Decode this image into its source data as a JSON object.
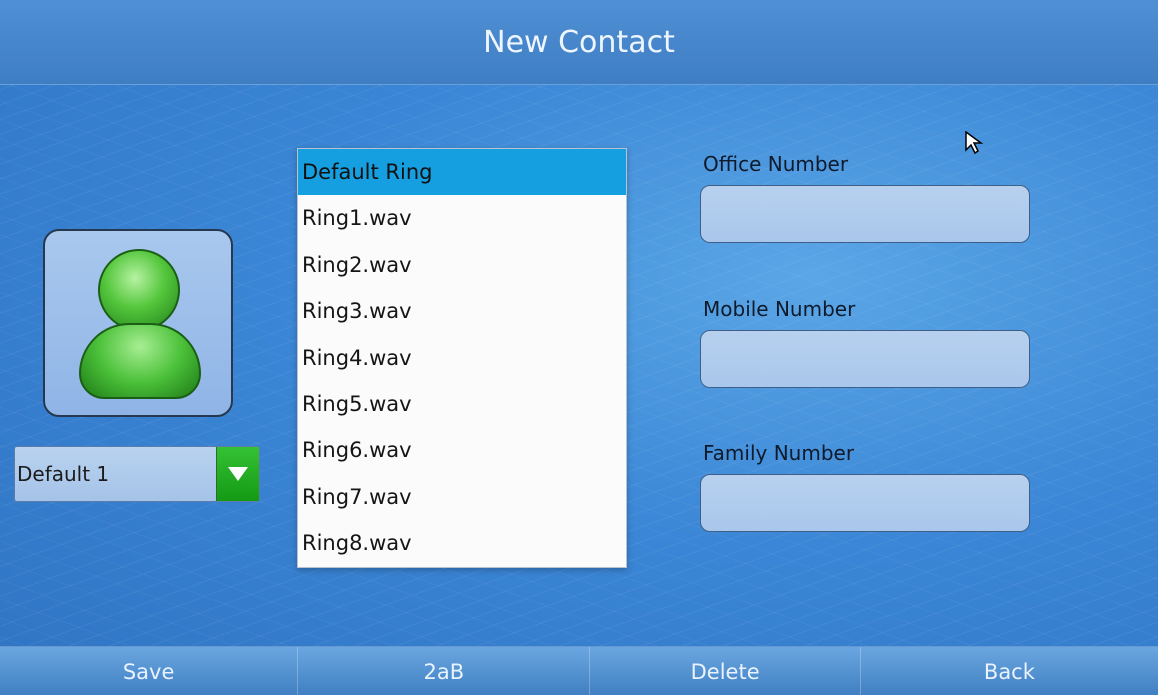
{
  "header": {
    "title": "New Contact"
  },
  "photo": {
    "select_value": "Default 1"
  },
  "ring_dropdown": {
    "items": [
      "Default Ring",
      "Ring1.wav",
      "Ring2.wav",
      "Ring3.wav",
      "Ring4.wav",
      "Ring5.wav",
      "Ring6.wav",
      "Ring7.wav",
      "Ring8.wav"
    ],
    "selected": "Default Ring"
  },
  "fields": {
    "office_label": "Office Number",
    "office_value": "",
    "mobile_label": "Mobile Number",
    "mobile_value": "",
    "family_label": "Family Number",
    "family_value": ""
  },
  "softkeys": [
    "Save",
    "2aB",
    "Delete",
    "Back"
  ],
  "colors": {
    "background": "#3b86d6",
    "titlebar": "#4f8fd4",
    "selected_item": "#169fe0",
    "dropdown_arrow": "#22a922"
  },
  "icons": {
    "avatar": "person-icon",
    "dropdown": "triangle-down-icon",
    "pointer": "mouse-pointer-icon"
  }
}
